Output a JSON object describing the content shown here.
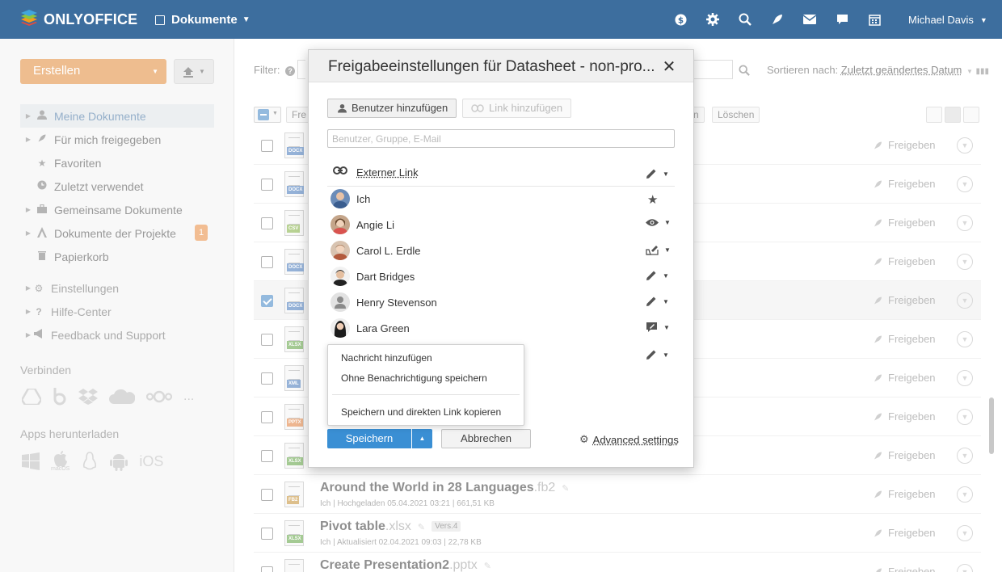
{
  "header": {
    "brand": "ONLYOFFICE",
    "module": "Dokumente",
    "icons": [
      "payments-icon",
      "settings-icon",
      "search-icon",
      "feed-icon",
      "mail-icon",
      "chat-icon",
      "calendar-icon"
    ],
    "user": "Michael Davis"
  },
  "sidebar": {
    "create_label": "Erstellen",
    "nav": [
      {
        "label": "Meine Dokumente",
        "icon": "user-icon",
        "active": true
      },
      {
        "label": "Für mich freigegeben",
        "icon": "shared-icon"
      },
      {
        "label": "Favoriten",
        "icon": "star-icon"
      },
      {
        "label": "Zuletzt verwendet",
        "icon": "clock-icon"
      },
      {
        "label": "Gemeinsame Dokumente",
        "icon": "briefcase-icon"
      },
      {
        "label": "Dokumente der Projekte",
        "icon": "projects-icon",
        "badge": "1"
      },
      {
        "label": "Papierkorb",
        "icon": "trash-icon"
      }
    ],
    "nav2": [
      {
        "label": "Einstellungen",
        "icon": "gear-icon"
      },
      {
        "label": "Hilfe-Center",
        "icon": "question-icon"
      },
      {
        "label": "Feedback und Support",
        "icon": "megaphone-icon"
      }
    ],
    "connect_title": "Verbinden",
    "connect_more": "...",
    "apps_title": "Apps herunterladen",
    "apps": [
      "windows",
      "macOS",
      "linux",
      "android",
      "iOS"
    ]
  },
  "main": {
    "filter_label": "Filter:",
    "sort_label": "Sortieren nach:",
    "sort_value": "Zuletzt geändertes Datum",
    "toolbar_share": "Fre",
    "toolbar_delete": "Löschen",
    "toolbar_n": "n",
    "share_label": "Freigeben",
    "rows": [
      {
        "tag": "DOCX",
        "tag_color": "#3f74b8",
        "selected": false
      },
      {
        "tag": "DOCX",
        "tag_color": "#3f74b8",
        "selected": false
      },
      {
        "tag": "CSV",
        "tag_color": "#7fae3b",
        "selected": false
      },
      {
        "tag": "DOCX",
        "tag_color": "#3f74b8",
        "selected": false
      },
      {
        "tag": "DOCX",
        "tag_color": "#3f74b8",
        "selected": true
      },
      {
        "tag": "XLSX",
        "tag_color": "#5a9f3b",
        "selected": false
      },
      {
        "tag": "XML",
        "tag_color": "#3f74b8",
        "selected": false
      },
      {
        "tag": "PPTX",
        "tag_color": "#e07a35",
        "selected": false
      },
      {
        "tag": "XLSX",
        "tag_color": "#5a9f3b",
        "selected": false
      },
      {
        "tag": "FB2",
        "tag_color": "#c28a2c",
        "selected": false,
        "name": "Around the World in 28 Languages",
        "ext": ".fb2",
        "meta": "Ich | Hochgeladen 05.04.2021 03:21 | 661,51 KB"
      },
      {
        "tag": "XLSX",
        "tag_color": "#5a9f3b",
        "selected": false,
        "name": "Pivot table",
        "ext": ".xlsx",
        "meta": "Ich | Aktualisiert 02.04.2021 09:03 | 22,78 KB",
        "version": "Vers.4"
      },
      {
        "tag": "PPTX",
        "tag_color": "#e07a35",
        "selected": false,
        "name": "Create Presentation2",
        "ext": ".pptx",
        "meta": ""
      }
    ]
  },
  "dialog": {
    "title": "Freigabeeinstellungen für Datasheet - non-pro...",
    "add_user": "Benutzer hinzufügen",
    "add_link": "Link hinzufügen",
    "search_placeholder": "Benutzer, Gruppe, E-Mail",
    "external_link": "Externer Link",
    "people": [
      {
        "name": "Ich",
        "access": "owner-star-icon"
      },
      {
        "name": "Angie Li",
        "access": "read-only-eye-icon"
      },
      {
        "name": "Carol L. Erdle",
        "access": "review-icon"
      },
      {
        "name": "Dart Bridges",
        "access": "full-access-pencil-icon"
      },
      {
        "name": "Henry Stevenson",
        "access": "full-access-pencil-icon"
      },
      {
        "name": "Lara Green",
        "access": "comment-icon"
      }
    ],
    "menu": {
      "item1": "Nachricht hinzufügen",
      "item2": "Ohne Benachrichtigung speichern",
      "item3": "Speichern und direkten Link kopieren"
    },
    "save": "Speichern",
    "cancel": "Abbrechen",
    "advanced": "Advanced settings"
  }
}
